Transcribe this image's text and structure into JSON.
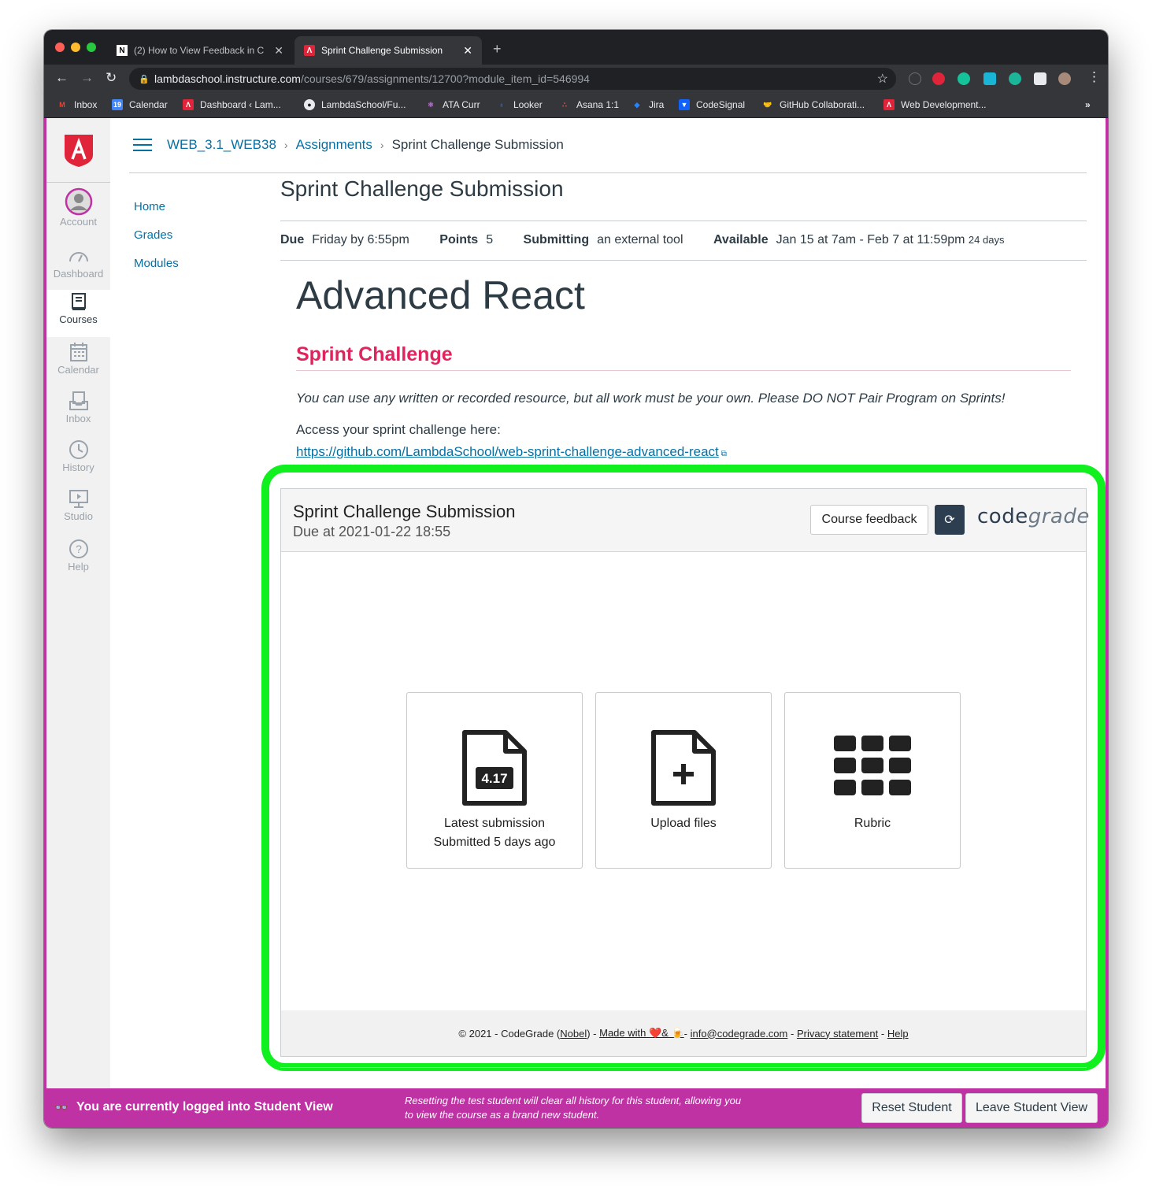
{
  "browser": {
    "tabs": [
      {
        "title": "(2) How to View Feedback in C"
      },
      {
        "title": "Sprint Challenge Submission"
      }
    ],
    "url_host": "lambdaschool.instructure.com",
    "url_path": "/courses/679/assignments/12700?module_item_id=546994",
    "bookmarks": [
      "Inbox",
      "Calendar",
      "Dashboard ‹ Lam...",
      "LambdaSchool/Fu...",
      "ATA Curr",
      "Looker",
      "Asana 1:1",
      "Jira",
      "CodeSignal",
      "GitHub Collaborati...",
      "Web Development..."
    ],
    "bookmarks_overflow": "»"
  },
  "global_nav": {
    "items": [
      {
        "label": "Account",
        "icon": "account-avatar-icon"
      },
      {
        "label": "Dashboard",
        "icon": "dashboard-icon"
      },
      {
        "label": "Courses",
        "icon": "courses-icon",
        "active": true
      },
      {
        "label": "Calendar",
        "icon": "calendar-icon"
      },
      {
        "label": "Inbox",
        "icon": "inbox-icon"
      },
      {
        "label": "History",
        "icon": "history-icon"
      },
      {
        "label": "Studio",
        "icon": "studio-icon"
      },
      {
        "label": "Help",
        "icon": "help-icon"
      }
    ]
  },
  "breadcrumb": {
    "course": "WEB_3.1_WEB38",
    "section": "Assignments",
    "current": "Sprint Challenge Submission"
  },
  "course_nav": [
    "Home",
    "Grades",
    "Modules"
  ],
  "assignment": {
    "title": "Sprint Challenge Submission",
    "due_label": "Due",
    "due_value": "Friday by 6:55pm",
    "points_label": "Points",
    "points_value": "5",
    "submitting_label": "Submitting",
    "submitting_value": "an external tool",
    "available_label": "Available",
    "available_value": "Jan 15 at 7am - Feb 7 at 11:59pm",
    "available_extra": "24 days",
    "heading": "Advanced React",
    "subheading": "Sprint Challenge",
    "notice": "You can use any written or recorded resource, but all work must be your own. Please DO NOT Pair Program on Sprints!",
    "access_text": "Access your sprint challenge here:",
    "link": "https://github.com/LambdaSchool/web-sprint-challenge-advanced-react"
  },
  "codegrade": {
    "title": "Sprint Challenge Submission",
    "due": "Due at 2021-01-22 18:55",
    "feedback_button": "Course feedback",
    "logo_code": "code",
    "logo_grade": "grade",
    "cards": [
      {
        "icon": "file-grade-icon",
        "grade": "4.17",
        "label1": "Latest submission",
        "label2": "Submitted 5 days ago"
      },
      {
        "icon": "file-plus-icon",
        "label1": "Upload files"
      },
      {
        "icon": "grid-icon",
        "label1": "Rubric"
      }
    ],
    "footer": {
      "copyright": "© 2021 - CodeGrade (",
      "nobel": "Nobel",
      "close_paren": ") - ",
      "made_with": "Made with ❤️& 🍺",
      "dash1": "- ",
      "email": "info@codegrade.com",
      "dash2": " - ",
      "privacy": "Privacy statement",
      "dash3": " - ",
      "help": "Help"
    }
  },
  "student_view": {
    "message": "You are currently logged into Student View",
    "note_line1": "Resetting the test student will clear all history for this student, allowing you",
    "note_line2": "to view the course as a brand new student.",
    "reset_button": "Reset Student",
    "leave_button": "Leave Student View"
  },
  "colors": {
    "accent": "#0770a3",
    "student_bar": "#bf32a4",
    "highlight": "#11f01f",
    "subheading": "#e0245e"
  }
}
